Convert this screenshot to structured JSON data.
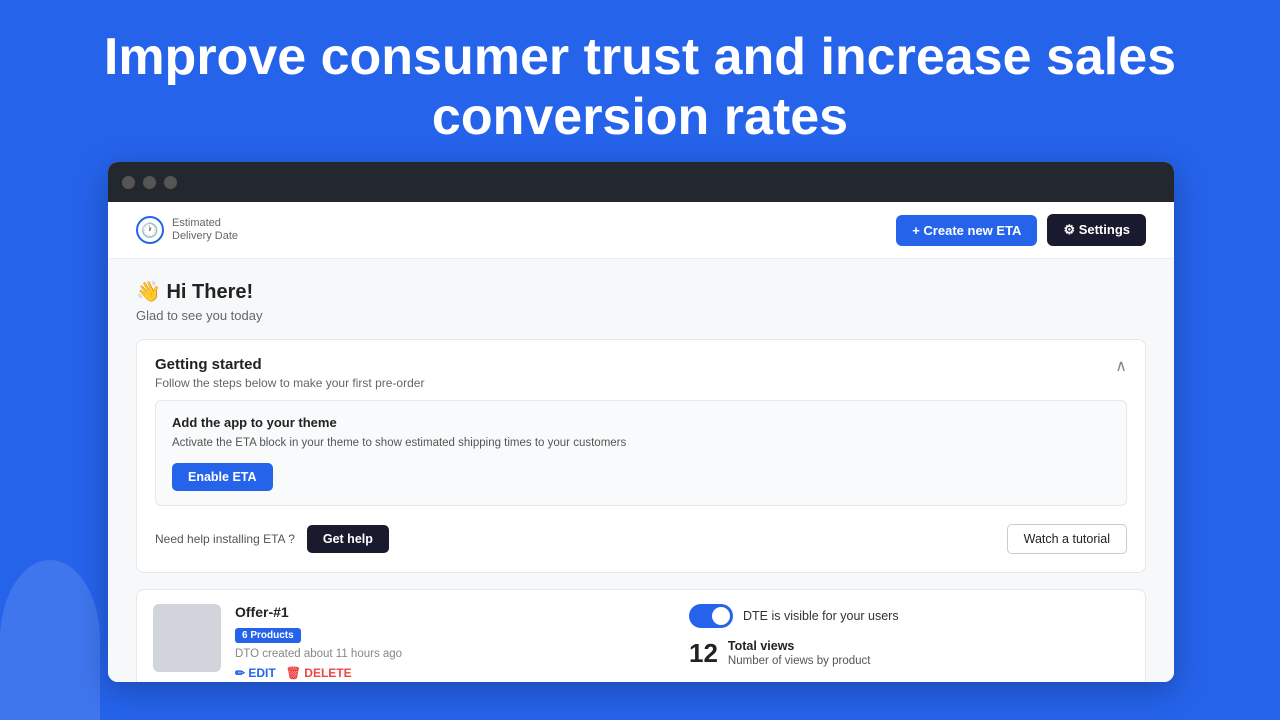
{
  "hero": {
    "line1": "Improve consumer trust and increase sales",
    "line2": "conversion rates"
  },
  "browser": {
    "dots": [
      "dot1",
      "dot2",
      "dot3"
    ]
  },
  "header": {
    "logo_line1": "Estimated",
    "logo_line2": "Delivery Date",
    "create_btn": "+ Create new ETA",
    "settings_btn": "⚙ Settings"
  },
  "greeting": {
    "emoji": "👋",
    "title": " Hi There!",
    "subtitle": "Glad to see you today"
  },
  "getting_started": {
    "title": "Getting started",
    "subtitle": "Follow the steps below to make your first pre-order",
    "theme_card": {
      "title": "Add the app to your theme",
      "description": "Activate the ETA block in your theme to show estimated shipping times to your customers",
      "button": "Enable ETA"
    },
    "help_text": "Need help installing ETA ?",
    "get_help_btn": "Get help",
    "watch_btn": "Watch a tutorial"
  },
  "offer": {
    "name": "Offer-#1",
    "badge": "6 Products",
    "meta": "DTO created about 11 hours ago",
    "edit_label": "✏ EDIT",
    "delete_label": "🗑 DELETE",
    "toggle_label": "DTE is visible for your users",
    "views_count": "12",
    "views_title": "Total views",
    "views_sub": "Number of views by product"
  },
  "icons": {
    "clock": "🕐",
    "chevron_up": "∧",
    "plus": "+"
  }
}
